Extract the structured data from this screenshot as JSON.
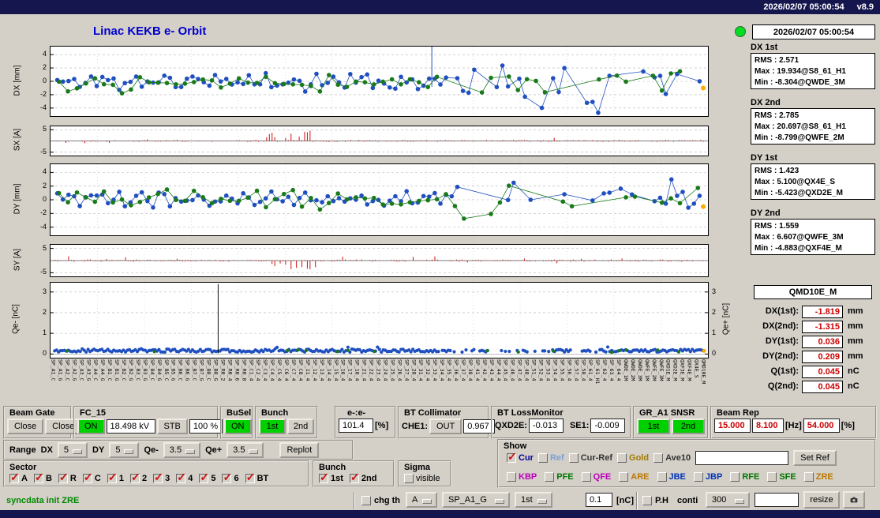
{
  "titlebar": {
    "datetime": "2026/02/07 05:00:54",
    "version": "v8.9"
  },
  "title": "Linac KEKB e- Orbit",
  "plots": {
    "dx": {
      "ylabel": "DX [mm]",
      "ticks": [
        4,
        2,
        0,
        -2,
        -4
      ],
      "ymin": -5.2,
      "ymax": 5.2,
      "seed": 11,
      "type": "orbit",
      "spike": 0.58
    },
    "sx": {
      "ylabel": "SX [A]",
      "ticks": [
        5,
        -5
      ],
      "ymin": -6.5,
      "ymax": 6.5,
      "seed": 22,
      "type": "bars",
      "cluster_at": 0.36,
      "cluster_sign": 1
    },
    "dy": {
      "ylabel": "DY [mm]",
      "ticks": [
        4,
        2,
        0,
        -2,
        -4
      ],
      "ymin": -5.2,
      "ymax": 5.2,
      "seed": 33,
      "type": "orbit"
    },
    "sy": {
      "ylabel": "SY [A]",
      "ticks": [
        5,
        -5
      ],
      "ymin": -6.5,
      "ymax": 6.5,
      "seed": 44,
      "type": "bars",
      "cluster_at": 0.37,
      "cluster_sign": -1
    },
    "qe": {
      "ylabel": "Qe- [nC]",
      "ylabel_right": "Qe+ [nC]",
      "ticks": [
        3,
        2,
        1,
        0
      ],
      "ticks_right": [
        3,
        2,
        1,
        0
      ],
      "ymin": -0.18,
      "ymax": 3.45,
      "seed": 55,
      "type": "qe",
      "black_line": 0.255
    }
  },
  "plot_colors": {
    "bunch1": "#2050c0",
    "bunch2": "#1a7a1a",
    "steering": "#cc1111",
    "marker_end": "#ffaa00"
  },
  "xlabels": [
    "SP_A1_C",
    "SP_A1_G",
    "SP_A2_C",
    "SP_A2_G",
    "SP_A3_C",
    "SP_A3_G",
    "SP_A4_C",
    "SP_A4_G",
    "SP_B1_C",
    "SP_B1_G",
    "SP_B2_C",
    "SP_B2_G",
    "SP_B3_C",
    "SP_B3_G",
    "SP_B4_C",
    "SP_B4_G",
    "SP_B5_C",
    "SP_B5_G",
    "SP_B6_C",
    "SP_B6_G",
    "SP_B7_C",
    "SP_B7_G",
    "SP_B8_C",
    "SP_B8_G",
    "SP_R0_2",
    "SP_R0_4",
    "SP_R0_6",
    "SP_R0_8",
    "SP_C1_4",
    "SP_C2_4",
    "SP_C3_4",
    "SP_C4_4",
    "SP_C5_4",
    "SP_C6_4",
    "SP_C7_4",
    "SP_C8_4",
    "SP_11_4",
    "SP_12_4",
    "SP_13_4",
    "SP_14_4",
    "SP_15_4",
    "SP_16_4",
    "SP_17_4",
    "SP_18_4",
    "SP_21_4",
    "SP_22_4",
    "SP_23_4",
    "SP_24_4",
    "SP_25_4",
    "SP_26_4",
    "SP_27_4",
    "SP_28_4",
    "SP_31_4",
    "SP_32_4",
    "SP_33_4",
    "SP_34_4",
    "SP_35_4",
    "SP_36_4",
    "SP_37_4",
    "SP_38_4",
    "SP_41_4",
    "SP_42_4",
    "SP_43_4",
    "SP_44_4",
    "SP_45_4",
    "SP_46_4",
    "SP_47_4",
    "SP_48_4",
    "SP_51_4",
    "SP_52_4",
    "SP_53_4",
    "SP_54_4",
    "SP_55_4",
    "SP_56_4",
    "SP_57_4",
    "SP_58_4",
    "SP_61_4",
    "SP_61_H1",
    "SP_62_4",
    "SP_63_4",
    "SP_64_4",
    "QWDE_1M",
    "QWDE_2M",
    "QWDE_3M",
    "QWFE_1M",
    "QWFE_2M",
    "QWFE_3M",
    "QXD1E_M",
    "QXD2E_M",
    "QXF3E_M",
    "QXF4E_M",
    "QX4E_S",
    "QMD10E_M"
  ],
  "status_panel": {
    "datetime": "2026/02/07 05:00:54",
    "groups": [
      {
        "label": "DX 1st",
        "rms": "RMS : 2.571",
        "max": "Max : 19.934@S8_61_H1",
        "min": "Min : -8.304@QWDE_3M"
      },
      {
        "label": "DX 2nd",
        "rms": "RMS : 2.785",
        "max": "Max : 20.697@S8_61_H1",
        "min": "Min : -8.799@QWFE_2M"
      },
      {
        "label": "DY 1st",
        "rms": "RMS : 1.423",
        "max": "Max : 5.100@QX4E_S",
        "min": "Min : -5.423@QXD2E_M"
      },
      {
        "label": "DY 2nd",
        "rms": "RMS : 1.559",
        "max": "Max : 6.607@QWFE_3M",
        "min": "Min : -4.883@QXF4E_M"
      }
    ]
  },
  "bpm_panel": {
    "title": "QMD10E_M",
    "rows": [
      {
        "label": "DX(1st):",
        "value": "-1.819",
        "unit": "mm"
      },
      {
        "label": "DX(2nd):",
        "value": "-1.315",
        "unit": "mm"
      },
      {
        "label": "DY(1st):",
        "value": "0.036",
        "unit": "mm"
      },
      {
        "label": "DY(2nd):",
        "value": "0.209",
        "unit": "mm"
      },
      {
        "label": "Q(1st):",
        "value": "0.045",
        "unit": "nC"
      },
      {
        "label": "Q(2nd):",
        "value": "0.045",
        "unit": "nC"
      }
    ]
  },
  "controls": {
    "beam_gate": {
      "label": "Beam Gate",
      "buttons": [
        "Close",
        "Close"
      ]
    },
    "fc15": {
      "label": "FC_15",
      "on": "ON",
      "kv": "18.498 kV",
      "stb": "STB",
      "pct": "100 %"
    },
    "busel": {
      "label": "BuSel",
      "on": "ON"
    },
    "bunch": {
      "label": "Bunch",
      "b1": "1st",
      "b2": "2nd"
    },
    "ee": {
      "label": "e-:e-",
      "value": "101.4",
      "unit": "[%]"
    },
    "bt_collimator": {
      "label": "BT Collimator",
      "che1_label": "CHE1:",
      "che1_value": "OUT",
      "value": "0.967"
    },
    "bt_lossmonitor": {
      "label": "BT LossMonitor",
      "qxd2e_label": "QXD2E:",
      "qxd2e": "-0.013",
      "se1_label": "SE1:",
      "se1": "-0.009"
    },
    "gr_a1": {
      "label": "GR_A1 SNSR",
      "b1": "1st",
      "b2": "2nd"
    },
    "beam_rep": {
      "label": "Beam Rep",
      "v1": "15.000",
      "v2": "8.100",
      "hz": "[Hz]",
      "v3": "54.000",
      "pct": "[%]"
    }
  },
  "range_row": {
    "label": "Range",
    "dx_label": "DX",
    "dx": "5",
    "dy_label": "DY",
    "dy": "5",
    "qem_label": "Qe-",
    "qem": "3.5",
    "qep_label": "Qe+",
    "qep": "3.5",
    "replot": "Replot"
  },
  "show_panel": {
    "label": "Show",
    "row1": [
      {
        "label": "Cur",
        "color": "#000099"
      },
      {
        "label": "Ref",
        "color": "#7b9fd4"
      },
      {
        "label": "Cur-Ref",
        "color": "#333333"
      },
      {
        "label": "Gold",
        "color": "#a07800"
      },
      {
        "label": "Ave10",
        "color": "#333333"
      }
    ],
    "set_ref": "Set Ref",
    "row2": [
      {
        "label": "KBP",
        "color": "#bb00bb"
      },
      {
        "label": "PFE",
        "color": "#007700"
      },
      {
        "label": "QFE",
        "color": "#bb00bb"
      },
      {
        "label": "ARE",
        "color": "#bb7700"
      },
      {
        "label": "JBE",
        "color": "#0033bb"
      },
      {
        "label": "JBP",
        "color": "#0033bb"
      },
      {
        "label": "RFE",
        "color": "#007700"
      },
      {
        "label": "SFE",
        "color": "#007700"
      },
      {
        "label": "ZRE",
        "color": "#bb7700"
      }
    ]
  },
  "sector_panel": {
    "label": "Sector",
    "items": [
      "A",
      "B",
      "R",
      "C",
      "1",
      "2",
      "3",
      "4",
      "5",
      "6",
      "BT"
    ]
  },
  "bunch_panel": {
    "label": "Bunch",
    "items": [
      "1st",
      "2nd"
    ]
  },
  "sigma_panel": {
    "label": "Sigma",
    "item": "visible"
  },
  "statusbar": {
    "message": "syncdata init ZRE",
    "chg_th": "chg th",
    "dd_a": "A",
    "dd_sp": "SP_A1_G",
    "dd_1st": "1st",
    "threshold": "0.1",
    "nc": "[nC]",
    "ph": "P.H",
    "conti": "conti",
    "dd_300": "300",
    "resize": "resize"
  }
}
